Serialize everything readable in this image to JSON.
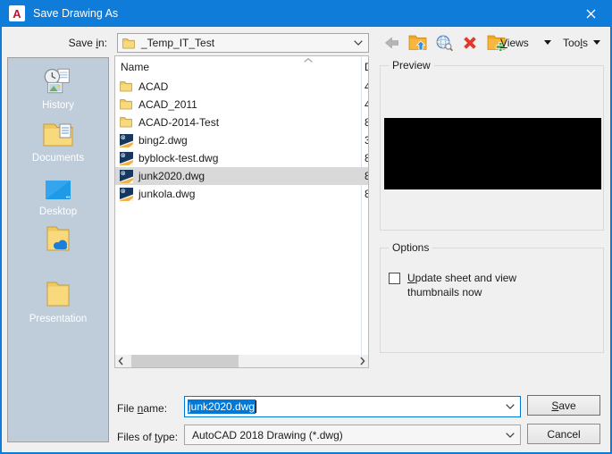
{
  "colors": {
    "titlebar": "#0f7cd9",
    "accent_focus": "#0078d7",
    "selection_inactive": "#d9d9d9",
    "sidebar_bg": "#bfccd9",
    "dialog_bg": "#f0f0f0",
    "delete_red": "#e03a2f",
    "folder_yellow": "#f3cd63",
    "dwg_navy": "#17375e"
  },
  "window": {
    "title": "Save Drawing As"
  },
  "icons": {
    "app": "autocad-a-logo",
    "close": "x-lines",
    "back": "gray-left-arrow",
    "up_folder": "folder-with-blue-up-arrow",
    "search_web": "globe-with-magnifier",
    "delete": "red-x",
    "new_folder": "folder-with-green-plus",
    "menu_caret": "black-down-triangle",
    "combo_chevron": "thin-down-chevron",
    "sort_asc": "up-chevron",
    "scroll_left": "left-chevron",
    "scroll_right": "right-chevron",
    "folder": "yellow-folder",
    "dwg": "autocad-dwg-file"
  },
  "header": {
    "save_in": {
      "pre": "Save ",
      "key": "i",
      "post": "n:"
    },
    "save_in_value": "_Temp_IT_Test",
    "views": {
      "pre": "",
      "key": "V",
      "post": "iews"
    },
    "tools": {
      "pre": "Too",
      "key": "l",
      "post": "s"
    }
  },
  "sidebar": {
    "items": [
      {
        "label": "History",
        "icon": "history-icon"
      },
      {
        "label": "Documents",
        "icon": "documents-icon"
      },
      {
        "label": "Desktop",
        "icon": "desktop-icon"
      },
      {
        "label": "",
        "icon": "onedrive-folder-icon"
      },
      {
        "label": "Presentation",
        "icon": "presentation-folder-icon"
      }
    ]
  },
  "file_list": {
    "columns": [
      {
        "label": "Name"
      },
      {
        "label": "D"
      }
    ],
    "rows": [
      {
        "name": "ACAD",
        "date": "4",
        "type": "folder",
        "selected": false
      },
      {
        "name": "ACAD_2011",
        "date": "4",
        "type": "folder",
        "selected": false
      },
      {
        "name": "ACAD-2014-Test",
        "date": "8",
        "type": "folder",
        "selected": false
      },
      {
        "name": "bing2.dwg",
        "date": "3",
        "type": "dwg",
        "selected": false
      },
      {
        "name": "byblock-test.dwg",
        "date": "8",
        "type": "dwg",
        "selected": false
      },
      {
        "name": "junk2020.dwg",
        "date": "8",
        "type": "dwg",
        "selected": true
      },
      {
        "name": "junkola.dwg",
        "date": "8",
        "type": "dwg",
        "selected": false
      }
    ]
  },
  "preview": {
    "title": "Preview"
  },
  "options": {
    "title": "Options",
    "checkbox": {
      "checked": false,
      "key": "U",
      "post": "pdate sheet and view",
      "line2": "thumbnails now"
    }
  },
  "footer": {
    "file_name": {
      "pre": "File ",
      "key": "n",
      "post": "ame:"
    },
    "file_name_value": "junk2020.dwg",
    "files_of_type": {
      "pre": "Files of ",
      "key": "t",
      "post": "ype:"
    },
    "files_of_type_value": "AutoCAD 2018 Drawing (*.dwg)",
    "save": {
      "pre": "",
      "key": "S",
      "post": "ave"
    },
    "cancel": "Cancel"
  }
}
